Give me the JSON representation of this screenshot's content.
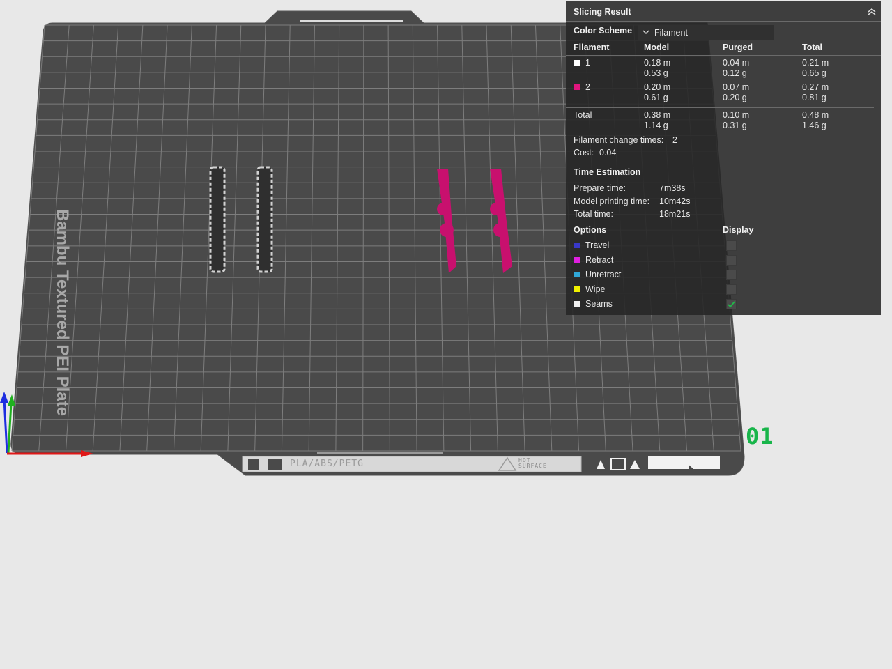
{
  "plate": {
    "name": "Bambu Textured PEI Plate",
    "material": "PLA/ABS/PETG",
    "hot_surface": [
      "HOT",
      "SURFACE"
    ],
    "number": "01",
    "number_color": "#18b54a"
  },
  "slicing_result": {
    "title": "Slicing Result",
    "color_scheme_label": "Color Scheme",
    "color_scheme_value": "Filament",
    "columns": [
      "Filament",
      "Model",
      "Purged",
      "Total"
    ],
    "filaments": [
      {
        "id": "1",
        "color": "#ffffff",
        "model": [
          "0.18 m",
          "0.53 g"
        ],
        "purged": [
          "0.04 m",
          "0.12 g"
        ],
        "total": [
          "0.21 m",
          "0.65 g"
        ]
      },
      {
        "id": "2",
        "color": "#e0157e",
        "model": [
          "0.20 m",
          "0.61 g"
        ],
        "purged": [
          "0.07 m",
          "0.20 g"
        ],
        "total": [
          "0.27 m",
          "0.81 g"
        ]
      }
    ],
    "total_row": {
      "label": "Total",
      "model": [
        "0.38 m",
        "1.14 g"
      ],
      "purged": [
        "0.10 m",
        "0.31 g"
      ],
      "total": [
        "0.48 m",
        "1.46 g"
      ]
    },
    "filament_change": {
      "label": "Filament change times:",
      "value": "2"
    },
    "cost": {
      "label": "Cost:",
      "value": "0.04"
    },
    "time_estimation": {
      "title": "Time Estimation",
      "rows": [
        {
          "label": "Prepare time:",
          "value": "7m38s"
        },
        {
          "label": "Model printing time:",
          "value": "10m42s"
        },
        {
          "label": "Total time:",
          "value": "18m21s"
        }
      ]
    },
    "options": {
      "title": "Options",
      "display_label": "Display",
      "items": [
        {
          "label": "Travel",
          "color": "#3838c8",
          "checked": false
        },
        {
          "label": "Retract",
          "color": "#e020e0",
          "checked": false
        },
        {
          "label": "Unretract",
          "color": "#30a8d8",
          "checked": false
        },
        {
          "label": "Wipe",
          "color": "#f0f000",
          "checked": false
        },
        {
          "label": "Seams",
          "color": "#f0f0f0",
          "checked": true
        }
      ]
    }
  },
  "colors": {
    "background": "#e8e8e8",
    "plate": "#4a4a4a",
    "grid": "#7d7d7d",
    "panel": "#262626",
    "magenta_model": "#c8106e",
    "white_model": "#d0d0d0"
  }
}
